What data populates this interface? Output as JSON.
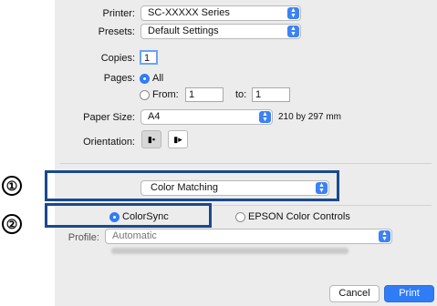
{
  "printer": {
    "label": "Printer:",
    "value": "SC-XXXXX Series"
  },
  "presets": {
    "label": "Presets:",
    "value": "Default Settings"
  },
  "copies": {
    "label": "Copies:",
    "value": "1"
  },
  "pages": {
    "label": "Pages:",
    "all_label": "All",
    "from_label": "From:",
    "from_value": "1",
    "to_label": "to:",
    "to_value": "1",
    "selected": "All"
  },
  "paper_size": {
    "label": "Paper Size:",
    "value": "A4",
    "dimensions": "210 by 297 mm"
  },
  "orientation": {
    "label": "Orientation:",
    "portrait_icon": "portrait-orientation-icon",
    "landscape_icon": "landscape-orientation-icon"
  },
  "section_popup": {
    "value": "Color Matching"
  },
  "color_matching": {
    "colorsync_label": "ColorSync",
    "epson_label": "EPSON Color Controls",
    "selected": "ColorSync"
  },
  "profile": {
    "label": "Profile:",
    "value": "Automatic"
  },
  "markers": {
    "one": "①",
    "two": "②"
  },
  "buttons": {
    "cancel": "Cancel",
    "print": "Print"
  },
  "colors": {
    "accent": "#3b82f6",
    "highlight_box": "#1a4a8c",
    "dialog_bg": "#ececec"
  }
}
